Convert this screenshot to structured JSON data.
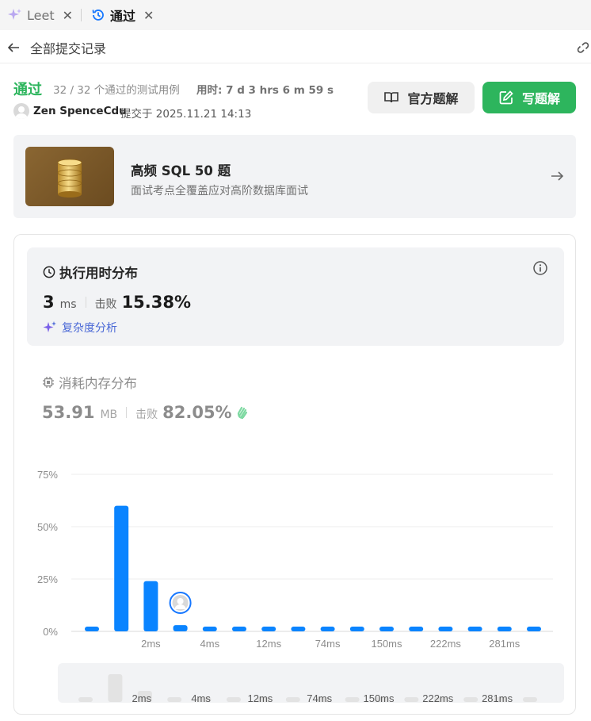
{
  "tabs": [
    {
      "label": "Leet",
      "close": "✕",
      "icon": "sparkle-icon"
    },
    {
      "label": "通过",
      "close": "✕",
      "icon": "history-icon"
    }
  ],
  "header": {
    "back_label": "全部提交记录"
  },
  "submission": {
    "status": "通过",
    "cases": "32 / 32  个通过的测试用例",
    "runtime": "用时: 7 d 3 hrs 6 m 59 s",
    "author": "Zen SpenceCdu",
    "submitted": "提交于 2025.11.21 14:13"
  },
  "buttons": {
    "official": "官方题解",
    "write": "写题解"
  },
  "plan": {
    "title": "高频 SQL 50 题",
    "subtitle": "面试考点全覆盖应对高阶数据库面试"
  },
  "runtime_card": {
    "title": "执行用时分布",
    "value": "3",
    "unit": "ms",
    "beat_label": "击败",
    "beat_value": "15.38%",
    "complexity": "复杂度分析"
  },
  "memory_card": {
    "title": "消耗内存分布",
    "value": "53.91",
    "unit": "MB",
    "beat_label": "击败",
    "beat_value": "82.05%"
  },
  "colors": {
    "accent_green": "#2db55d",
    "bar_blue": "#0a84ff"
  },
  "chart_data": {
    "type": "bar",
    "title": "",
    "xlabel": "",
    "ylabel": "",
    "ylim": [
      0,
      75
    ],
    "y_ticks": [
      "75%",
      "50%",
      "25%",
      "0%"
    ],
    "x_tick_labels": [
      "2ms",
      "4ms",
      "12ms",
      "74ms",
      "150ms",
      "222ms",
      "281ms"
    ],
    "series": [
      {
        "values": [
          2,
          60,
          24,
          3,
          2,
          2,
          2,
          2,
          2,
          2,
          2,
          2,
          2,
          2,
          2,
          2
        ]
      }
    ],
    "highlight_index": 3
  }
}
